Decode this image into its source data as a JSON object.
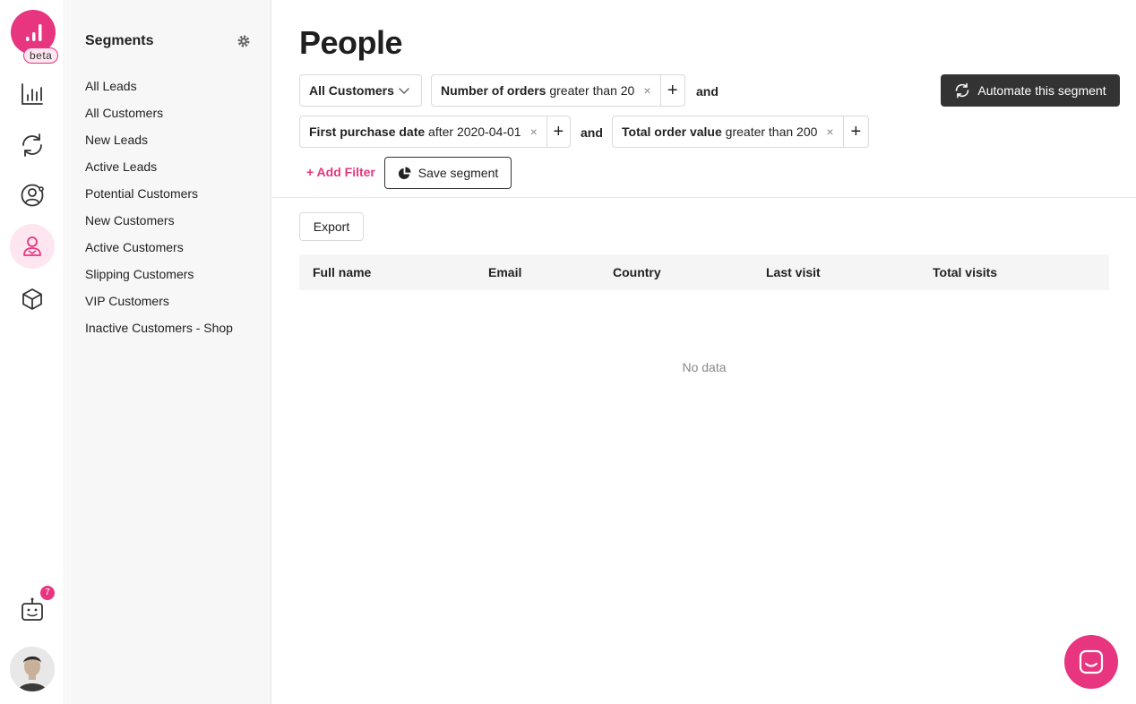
{
  "app": {
    "beta_label": "beta",
    "notification_count": "7"
  },
  "rail": {
    "icons": [
      "bar-chart-icon",
      "sync-icon",
      "user-circle-icon",
      "person-icon",
      "cube-icon",
      "robot-icon"
    ]
  },
  "segments": {
    "title": "Segments",
    "items": [
      "All Leads",
      "All Customers",
      "New Leads",
      "Active Leads",
      "Potential Customers",
      "New Customers",
      "Active Customers",
      "Slipping Customers",
      "VIP Customers",
      "Inactive Customers - Shop"
    ]
  },
  "main": {
    "title": "People",
    "customer_select": "All Customers",
    "filters": [
      {
        "field": "Number of orders",
        "condition": "greater than 20"
      },
      {
        "field": "First purchase date",
        "condition": "after 2020-04-01"
      },
      {
        "field": "Total order value",
        "condition": "greater than 200"
      }
    ],
    "and_label": "and",
    "remove_glyph": "×",
    "add_glyph": "+",
    "automate_label": "Automate this segment",
    "add_filter_label": "+ Add Filter",
    "save_segment_label": "Save segment",
    "export_label": "Export",
    "table": {
      "columns": [
        "Full name",
        "Email",
        "Country",
        "Last visit",
        "Total visits"
      ],
      "empty_text": "No data"
    }
  },
  "colors": {
    "accent": "#e8357f",
    "dark_button": "#333333",
    "sidebar_bg": "#f7f7f7"
  }
}
